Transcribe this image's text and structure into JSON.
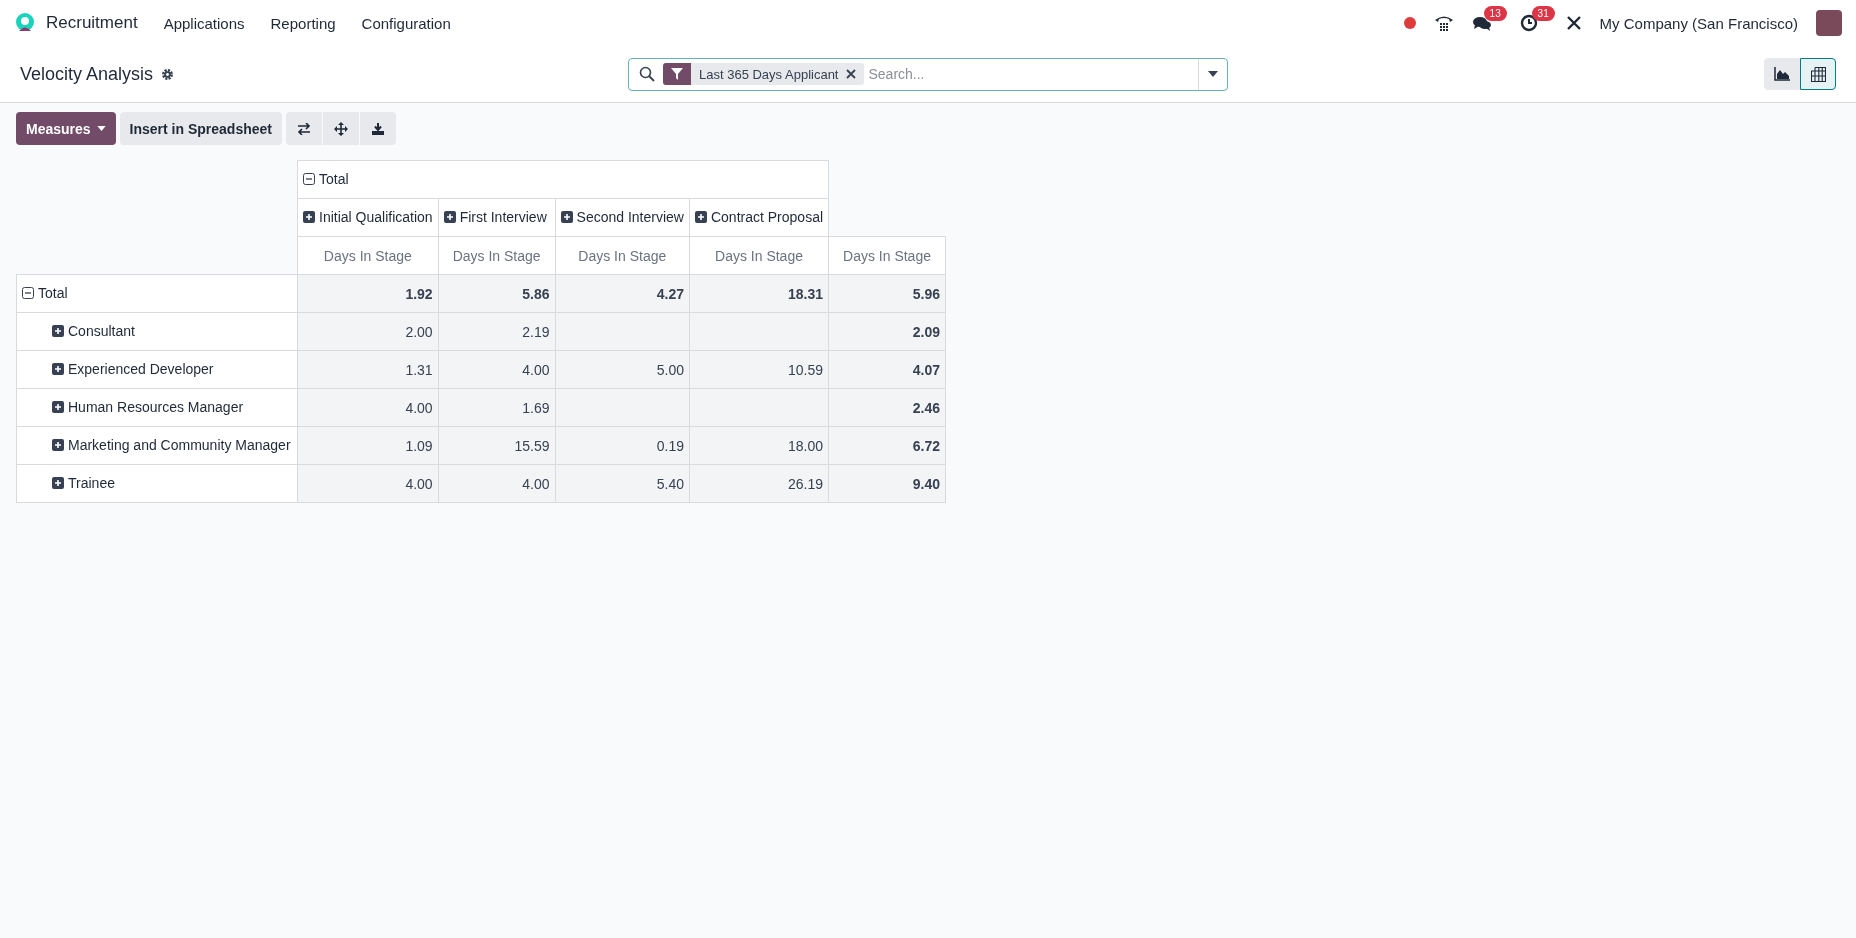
{
  "navbar": {
    "app": "Recruitment",
    "menus": [
      "Applications",
      "Reporting",
      "Configuration"
    ],
    "messages_count": "13",
    "activities_count": "31",
    "company": "My Company (San Francisco)"
  },
  "control_panel": {
    "title": "Velocity Analysis",
    "facet": "Last 365 Days Applicant",
    "search": {
      "placeholder": "Search..."
    },
    "views": [
      {
        "kind": "graph",
        "selected": false
      },
      {
        "kind": "pivot",
        "selected": true
      }
    ]
  },
  "toolbar": {
    "measures": "Measures",
    "insert": "Insert in Spreadsheet"
  },
  "pivot": {
    "col_header": {
      "label": "Total",
      "expanded": true
    },
    "columns": [
      {
        "label": "Initial Qualification",
        "expanded": false
      },
      {
        "label": "First Interview",
        "expanded": false
      },
      {
        "label": "Second Interview",
        "expanded": false
      },
      {
        "label": "Contract Proposal",
        "expanded": false
      }
    ],
    "measure_headers": [
      "Days In Stage",
      "Days In Stage",
      "Days In Stage",
      "Days In Stage",
      "Days In Stage"
    ],
    "total_row": {
      "label": "Total",
      "expanded": true,
      "values": {
        "initial_qualification": "1.92",
        "first_interview": "5.86",
        "second_interview": "4.27",
        "contract_proposal": "18.31",
        "total": "5.96"
      }
    },
    "rows": [
      {
        "label": "Consultant",
        "expanded": false,
        "values": {
          "initial_qualification": "2.00",
          "first_interview": "2.19",
          "total": "2.09"
        }
      },
      {
        "label": "Experienced Developer",
        "expanded": false,
        "values": {
          "initial_qualification": "1.31",
          "first_interview": "4.00",
          "second_interview": "5.00",
          "contract_proposal": "10.59",
          "total": "4.07"
        }
      },
      {
        "label": "Human Resources Manager",
        "expanded": false,
        "values": {
          "initial_qualification": "4.00",
          "first_interview": "1.69",
          "total": "2.46"
        }
      },
      {
        "label": "Marketing and Community Manager",
        "expanded": false,
        "values": {
          "initial_qualification": "1.09",
          "first_interview": "15.59",
          "second_interview": "0.19",
          "contract_proposal": "18.00",
          "total": "6.72"
        }
      },
      {
        "label": "Trainee",
        "expanded": false,
        "values": {
          "initial_qualification": "4.00",
          "first_interview": "4.00",
          "second_interview": "5.40",
          "contract_proposal": "26.19",
          "total": "9.40"
        }
      }
    ]
  }
}
